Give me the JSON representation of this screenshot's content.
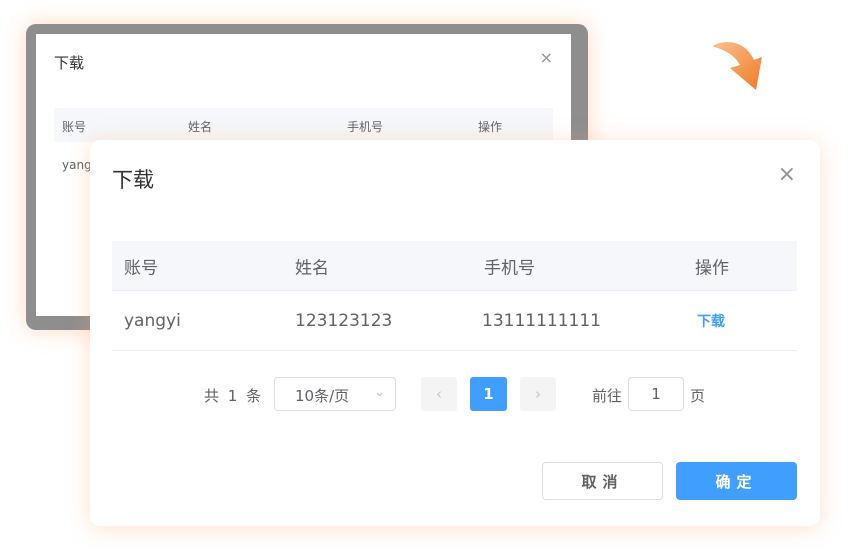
{
  "back_dialog": {
    "title": "下载",
    "close_glyph": "×",
    "columns": [
      "账号",
      "姓名",
      "手机号",
      "操作"
    ],
    "partial_cell": "yang"
  },
  "dialog": {
    "title": "下载",
    "close_glyph": "×",
    "columns": [
      "账号",
      "姓名",
      "手机号",
      "操作"
    ],
    "rows": [
      {
        "account": "yangyi",
        "name": "123123123",
        "phone": "13111111111",
        "action": "下载"
      }
    ],
    "pagination": {
      "total_text": "共 1 条",
      "page_size": "10条/页",
      "prev_glyph": "‹",
      "next_glyph": "›",
      "current_page": "1",
      "goto_label": "前往",
      "goto_value": "1",
      "page_suffix": "页"
    },
    "buttons": {
      "cancel": "取消",
      "confirm": "确定"
    }
  },
  "icons": {
    "close": "close-icon",
    "arrow": "curved-arrow-down-icon",
    "select": "chevron-down-icon"
  },
  "colors": {
    "primary": "#409eff",
    "arrow": "#f48a3c",
    "header_bg": "#f5f7fa",
    "overlay_gray": "#8e8e8e"
  }
}
